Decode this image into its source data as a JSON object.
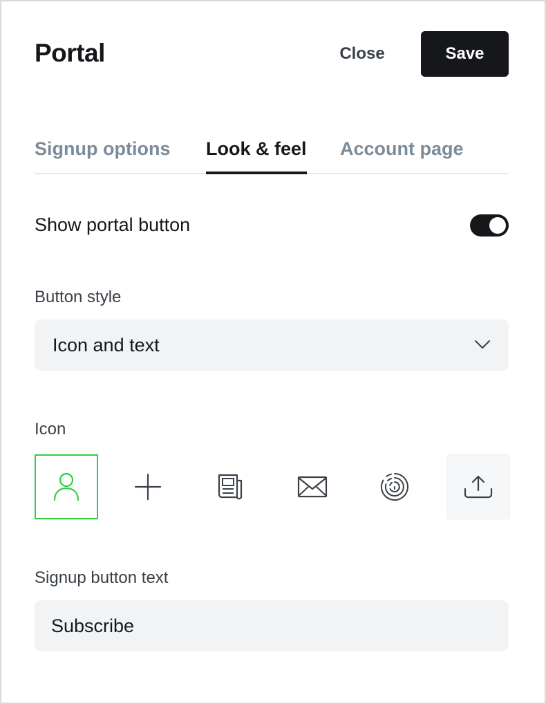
{
  "header": {
    "title": "Portal",
    "close_label": "Close",
    "save_label": "Save"
  },
  "tabs": [
    {
      "label": "Signup options",
      "active": false
    },
    {
      "label": "Look & feel",
      "active": true
    },
    {
      "label": "Account page",
      "active": false
    }
  ],
  "show_portal_button": {
    "label": "Show portal button",
    "enabled": true
  },
  "button_style": {
    "label": "Button style",
    "selected": "Icon and text"
  },
  "icon": {
    "label": "Icon",
    "options": [
      "user-icon",
      "plus-icon",
      "newspaper-icon",
      "envelope-icon",
      "fingerprint-icon",
      "upload-icon"
    ],
    "selected": "user-icon"
  },
  "signup_button": {
    "label": "Signup button text",
    "value": "Subscribe"
  },
  "colors": {
    "accent": "#30cf43",
    "primary": "#15171a",
    "tab_inactive": "#7c8b9a",
    "input_bg": "#f2f3f4"
  }
}
